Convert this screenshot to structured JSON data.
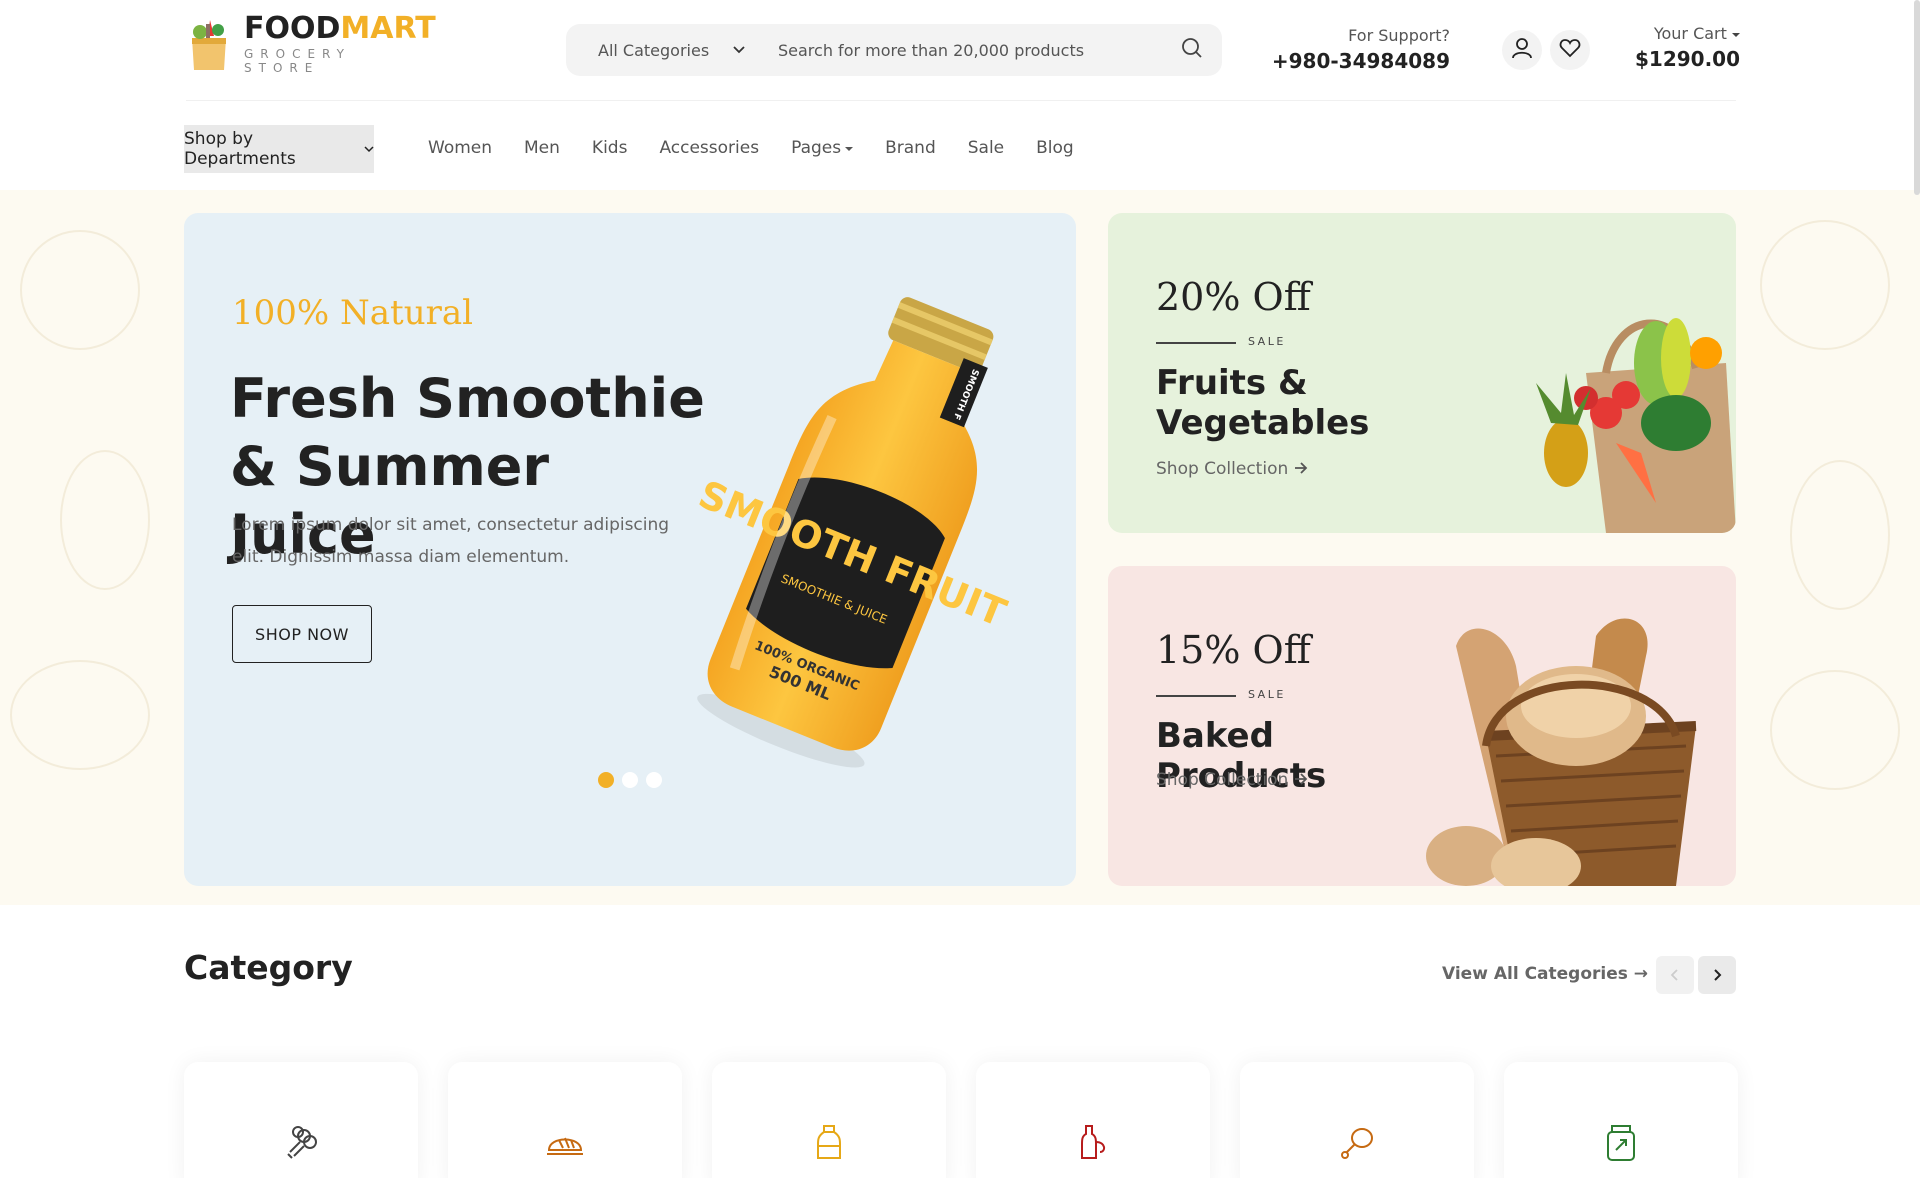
{
  "logo": {
    "brand_part1": "FOOD",
    "brand_part2": "MART",
    "tagline": "GROCERY STORE"
  },
  "search": {
    "category_selected": "All Categories",
    "placeholder": "Search for more than 20,000 products",
    "value": ""
  },
  "support": {
    "label": "For Support?",
    "phone": "+980-34984089"
  },
  "cart": {
    "label": "Your Cart",
    "total": "$1290.00"
  },
  "icons": {
    "user": "user-icon",
    "wishlist": "heart-icon",
    "search": "search-icon"
  },
  "nav": {
    "departments_label": "Shop by Departments",
    "links": [
      "Women",
      "Men",
      "Kids",
      "Accessories",
      "Pages",
      "Brand",
      "Sale",
      "Blog"
    ]
  },
  "hero": {
    "tag": "100% Natural",
    "title": "Fresh Smoothie & Summer Juice",
    "description": "Lorem ipsum dolor sit amet, consectetur adipiscing elit. Dignissim massa diam elementum.",
    "button_label": "SHOP NOW",
    "bottle_label_top": "SMOOTH FRUIT",
    "bottle_label_sub": "SMOOTHIE & JUICE",
    "bottle_label_organic": "100% ORGANIC",
    "bottle_label_volume": "500 ML",
    "bottle_cap_text": "SMOOTH F",
    "slides_count": 3,
    "active_slide": 1
  },
  "promos": [
    {
      "discount": "20% Off",
      "sale_label": "SALE",
      "title": "Fruits & Vegetables",
      "link": "Shop Collection"
    },
    {
      "discount": "15% Off",
      "sale_label": "SALE",
      "title": "Baked Products",
      "link": "Shop Collection"
    }
  ],
  "category": {
    "title": "Category",
    "view_all": "View All Categories →",
    "items": [
      {
        "icon": "broccoli-icon"
      },
      {
        "icon": "bread-icon"
      },
      {
        "icon": "juice-bottle-icon"
      },
      {
        "icon": "wine-icon"
      },
      {
        "icon": "meat-drumstick-icon"
      },
      {
        "icon": "jar-icon"
      }
    ]
  },
  "colors": {
    "accent": "#f2b027",
    "hero_bg": "#e6f0f6",
    "promo_green": "#e6f2dc",
    "promo_pink": "#f8e6e3",
    "page_bg": "#fdfaf1"
  }
}
